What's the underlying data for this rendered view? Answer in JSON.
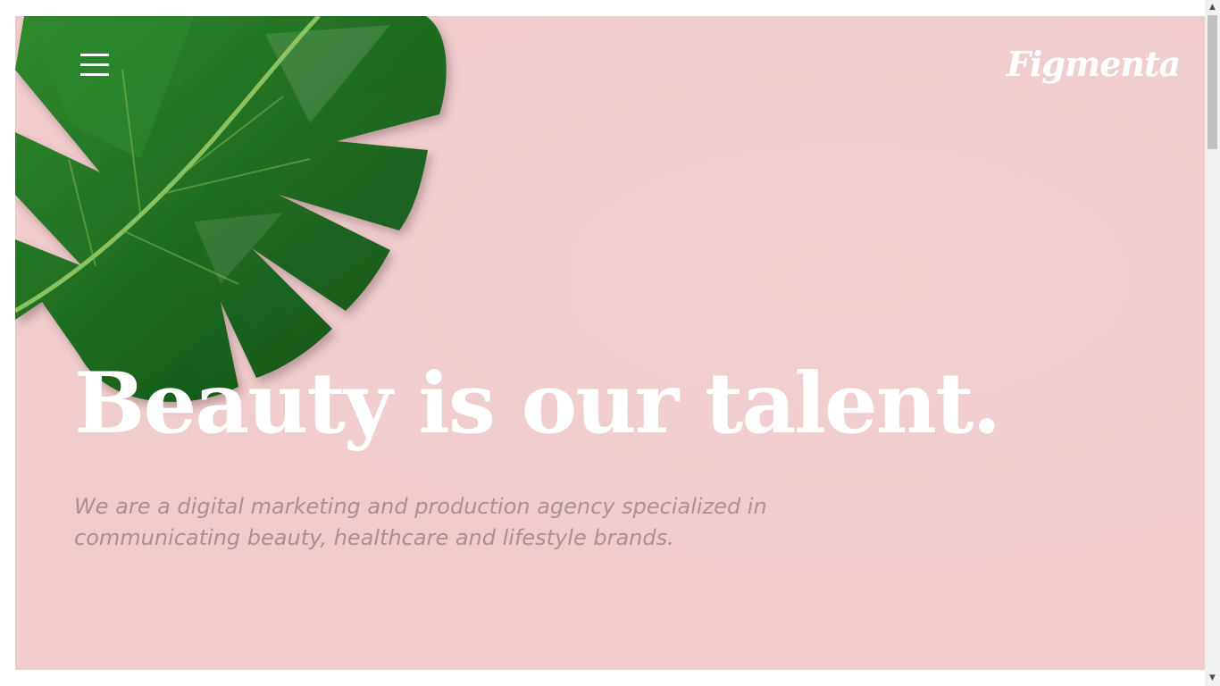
{
  "brand": {
    "logo_text": "Figmenta",
    "background_color": "#f0cccd",
    "leaf_color": "#1f6b22"
  },
  "nav": {
    "menu_icon": "hamburger-menu-icon"
  },
  "hero": {
    "headline": "Beauty is our talent.",
    "subheadline": "We are a digital marketing and production agency specialized in communicating beauty, healthcare and lifestyle brands."
  },
  "scrollbar": {
    "up_icon": "scroll-up-arrow-icon",
    "down_icon": "scroll-down-arrow-icon"
  }
}
